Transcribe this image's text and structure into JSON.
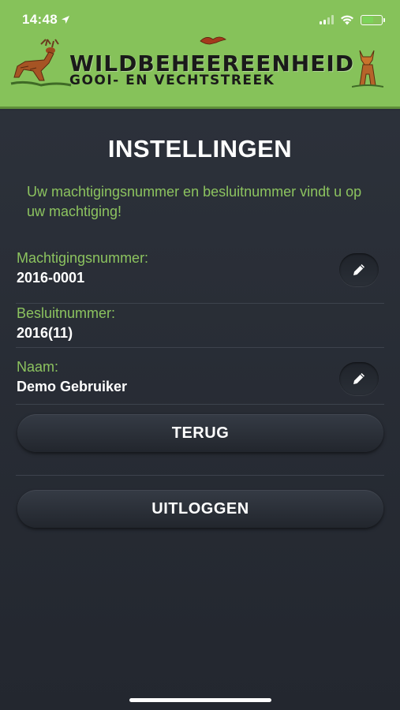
{
  "status_bar": {
    "time": "14:48",
    "location_icon": "location-arrow-icon",
    "signal_icon": "cellular-signal-icon",
    "wifi_icon": "wifi-icon",
    "battery_icon": "battery-charging-icon",
    "battery_level": 0.6
  },
  "header": {
    "org_name": "WILDBEHEEREENHEID",
    "org_region": "GOOI- EN VECHTSTREEK",
    "background_color": "#86c25a"
  },
  "page": {
    "title": "INSTELLINGEN",
    "intro": "Uw machtigingsnummer en besluitnummer vindt u op uw machtiging!"
  },
  "fields": [
    {
      "label": "Machtigingsnummer:",
      "value": "2016-0001",
      "editable": true
    },
    {
      "label": "Besluitnummer:",
      "value": "2016(11)",
      "editable": false
    },
    {
      "label": "Naam:",
      "value": "Demo Gebruiker",
      "editable": true
    }
  ],
  "buttons": {
    "back": "TERUG",
    "logout": "UITLOGGEN"
  },
  "colors": {
    "accent": "#8cc35f",
    "background": "#2a2f38"
  }
}
